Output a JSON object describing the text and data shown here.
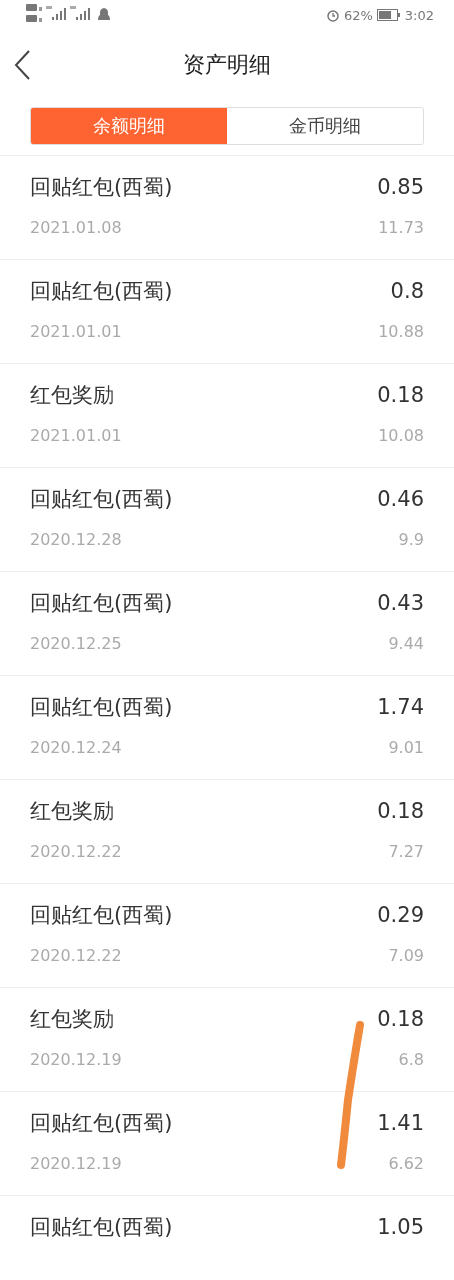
{
  "status_bar": {
    "battery_text": "62%",
    "time": "3:02"
  },
  "header": {
    "title": "资产明细"
  },
  "tabs": [
    {
      "label": "余额明细",
      "selected": true
    },
    {
      "label": "金币明细",
      "selected": false
    }
  ],
  "records": [
    {
      "name": "回贴红包(西蜀)",
      "amount": "0.85",
      "date": "2021.01.08",
      "balance": "11.73"
    },
    {
      "name": "回贴红包(西蜀)",
      "amount": "0.8",
      "date": "2021.01.01",
      "balance": "10.88"
    },
    {
      "name": "红包奖励",
      "amount": "0.18",
      "date": "2021.01.01",
      "balance": "10.08"
    },
    {
      "name": "回贴红包(西蜀)",
      "amount": "0.46",
      "date": "2020.12.28",
      "balance": "9.9"
    },
    {
      "name": "回贴红包(西蜀)",
      "amount": "0.43",
      "date": "2020.12.25",
      "balance": "9.44"
    },
    {
      "name": "回贴红包(西蜀)",
      "amount": "1.74",
      "date": "2020.12.24",
      "balance": "9.01"
    },
    {
      "name": "红包奖励",
      "amount": "0.18",
      "date": "2020.12.22",
      "balance": "7.27"
    },
    {
      "name": "回贴红包(西蜀)",
      "amount": "0.29",
      "date": "2020.12.22",
      "balance": "7.09"
    },
    {
      "name": "红包奖励",
      "amount": "0.18",
      "date": "2020.12.19",
      "balance": "6.8"
    },
    {
      "name": "回贴红包(西蜀)",
      "amount": "1.41",
      "date": "2020.12.19",
      "balance": "6.62"
    },
    {
      "name": "回贴红包(西蜀)",
      "amount": "1.05"
    }
  ]
}
